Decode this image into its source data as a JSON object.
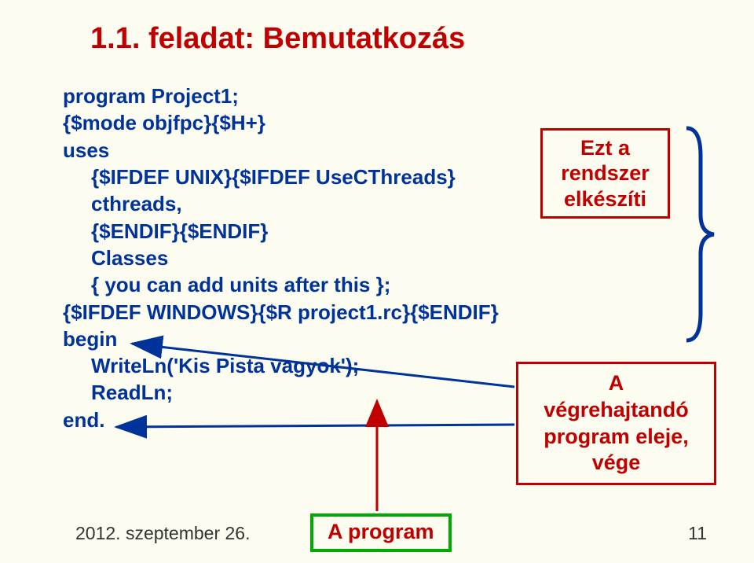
{
  "title": "1.1. feladat: Bemutatkozás",
  "code": {
    "l1": "program Project1;",
    "l2": "{$mode objfpc}{$H+}",
    "l3": "uses",
    "l4": "{$IFDEF UNIX}{$IFDEF UseCThreads}",
    "l5": "cthreads,",
    "l6": "{$ENDIF}{$ENDIF}",
    "l7": "Classes",
    "l8": "{ you can add units after this };",
    "l9": "{$IFDEF WINDOWS}{$R project1.rc}{$ENDIF}",
    "l10": "begin",
    "l11": "WriteLn('Kis Pista vagyok');",
    "l12": "ReadLn;",
    "l13": "end."
  },
  "annotation1": {
    "l1": "Ezt a",
    "l2": "rendszer",
    "l3": "elkészíti"
  },
  "annotation2": {
    "l1": "A",
    "l2": "végrehajtandó",
    "l3": "program eleje,",
    "l4": "vége"
  },
  "footer_date": "2012. szeptember 26.",
  "footer_page": "11",
  "program_label": "A program"
}
